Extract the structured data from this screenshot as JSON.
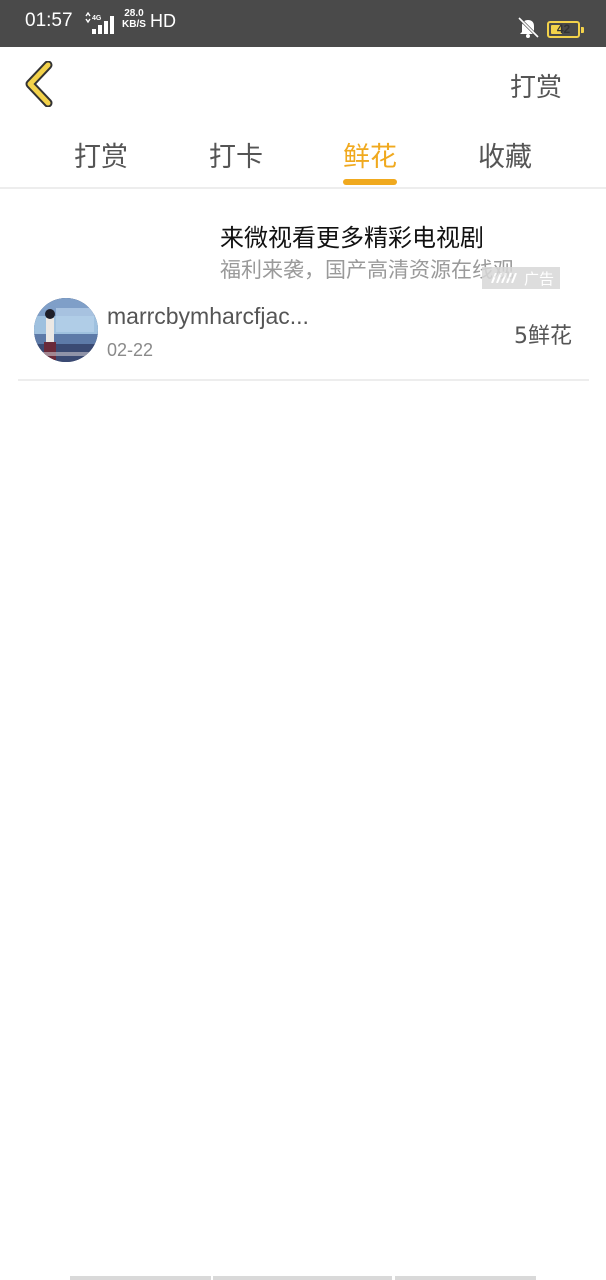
{
  "status_bar": {
    "time": "01:57",
    "network": "4G",
    "speed_value": "28.0",
    "speed_unit": "KB/S",
    "hd": "HD",
    "battery": "42",
    "battery_level": 0.42
  },
  "nav": {
    "right_label": "打赏"
  },
  "tabs": [
    {
      "label": "打赏",
      "active": false
    },
    {
      "label": "打卡",
      "active": false
    },
    {
      "label": "鲜花",
      "active": true
    },
    {
      "label": "收藏",
      "active": false
    }
  ],
  "ad": {
    "title": "来微视看更多精彩电视剧",
    "subtitle": "福利来袭，国产高清资源在线观",
    "tag": "广告"
  },
  "records": [
    {
      "username": "marrcbymharcfjac...",
      "date": "02-22",
      "count": "5鲜花"
    }
  ],
  "colors": {
    "accent": "#f0a91e",
    "status_bar": "#4a4a4a",
    "text": "#555555",
    "muted": "#9a9a9a"
  },
  "icons": {
    "back": "chevron-left-icon",
    "bell": "bell-muted-icon",
    "battery": "battery-icon",
    "signal": "signal-icon"
  }
}
